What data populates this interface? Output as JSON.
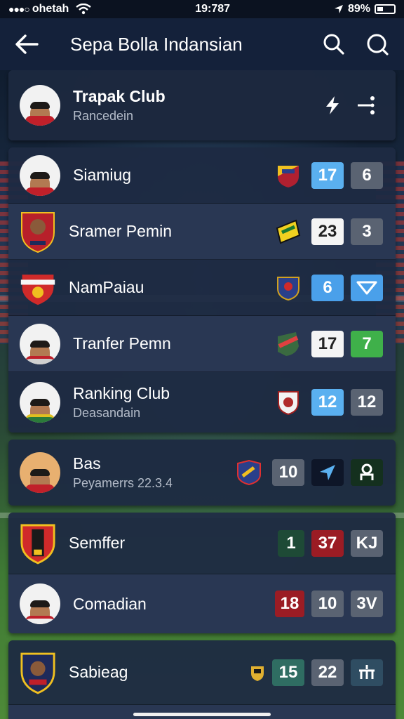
{
  "status_bar": {
    "carrier": "ohetah",
    "time": "19:787",
    "battery": "89%"
  },
  "app_bar": {
    "title": "Sepa Bolla Indansian"
  },
  "header_card": {
    "name": "Trapak Club",
    "subtitle": "Rancedein"
  },
  "group1": [
    {
      "name": "Siamiug",
      "badges": [
        {
          "text": "17",
          "kind": "blue"
        },
        {
          "text": "6",
          "kind": "grey"
        }
      ]
    },
    {
      "name": "Sramer Pemin",
      "badges": [
        {
          "text": "23",
          "kind": "white"
        },
        {
          "text": "3",
          "kind": "grey"
        }
      ]
    },
    {
      "name": "NamPaiau",
      "badges": [
        {
          "text": "6",
          "kind": "blue"
        },
        {
          "text": "",
          "kind": "blue",
          "icon": "chevron-down-icon"
        }
      ]
    },
    {
      "name": "Tranfer Pemn",
      "badges": [
        {
          "text": "17",
          "kind": "white"
        },
        {
          "text": "7",
          "kind": "green"
        }
      ]
    },
    {
      "name": "Ranking Club",
      "subtitle": "Deasandain",
      "badges": [
        {
          "text": "12",
          "kind": "blue"
        },
        {
          "text": "12",
          "kind": "grey"
        }
      ]
    }
  ],
  "bas_card": {
    "name": "Bas",
    "subtitle": "Peyamerrs 22.3.4",
    "badges": [
      {
        "text": "10",
        "kind": "grey"
      }
    ]
  },
  "group2": [
    {
      "name": "Semffer",
      "badges": [
        {
          "text": "1",
          "kind": "darkgreen"
        },
        {
          "text": "37",
          "kind": "red"
        },
        {
          "text": "KJ",
          "kind": "grey"
        }
      ]
    },
    {
      "name": "Comadian",
      "badges": [
        {
          "text": "18",
          "kind": "red"
        },
        {
          "text": "10",
          "kind": "grey"
        },
        {
          "text": "3V",
          "kind": "grey"
        }
      ]
    }
  ],
  "group3": [
    {
      "name": "Sabieag",
      "badges": [
        {
          "text": "15",
          "kind": "teal"
        },
        {
          "text": "22",
          "kind": "grey"
        }
      ]
    }
  ],
  "colors": {
    "blue": "#5ab0f0",
    "grey": "#5a6372",
    "white": "#f4f4f4",
    "green": "#3fb04a",
    "red": "#9b1c24",
    "darkgreen": "#1e4a36",
    "teal": "#2f6d62",
    "accent": "#14213a"
  }
}
